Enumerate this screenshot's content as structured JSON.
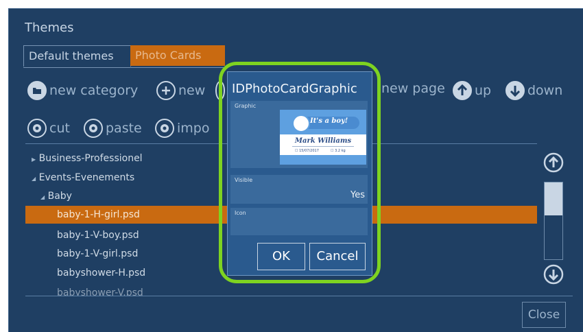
{
  "window": {
    "title": "Themes"
  },
  "tabs": [
    {
      "label": "Default themes"
    },
    {
      "label": "Photo Cards"
    }
  ],
  "toolbar": {
    "new_category": "new category",
    "new": "new",
    "new_page": "new page",
    "up": "up",
    "down": "down",
    "cut": "cut",
    "paste": "paste",
    "import": "impo"
  },
  "tree": {
    "items": [
      {
        "label": "Business-Professionel"
      },
      {
        "label": "Events-Evenements"
      },
      {
        "label": "Baby"
      },
      {
        "label": "baby-1-H-girl.psd"
      },
      {
        "label": "baby-1-V-boy.psd"
      },
      {
        "label": "baby-1-V-girl.psd"
      },
      {
        "label": "babyshower-H.psd"
      },
      {
        "label": "babyshower-V.psd"
      }
    ],
    "scroll_position": 0
  },
  "close_label": "Close",
  "dialog": {
    "title": "IDPhotoCardGraphic",
    "graphic_label": "Graphic",
    "card_tagline": "It's a boy!",
    "card_name": "Mark Williams",
    "card_date": "☐ 15/07/2017",
    "card_weight": "☐ 3.2 kg",
    "visible_label": "Visible",
    "visible_value": "Yes",
    "icon_label": "Icon",
    "ok_label": "OK",
    "cancel_label": "Cancel"
  },
  "colors": {
    "background": "#1f3f63",
    "accent": "#c96a11",
    "dialog": "#2a5a8e",
    "highlight": "#7ed321"
  }
}
